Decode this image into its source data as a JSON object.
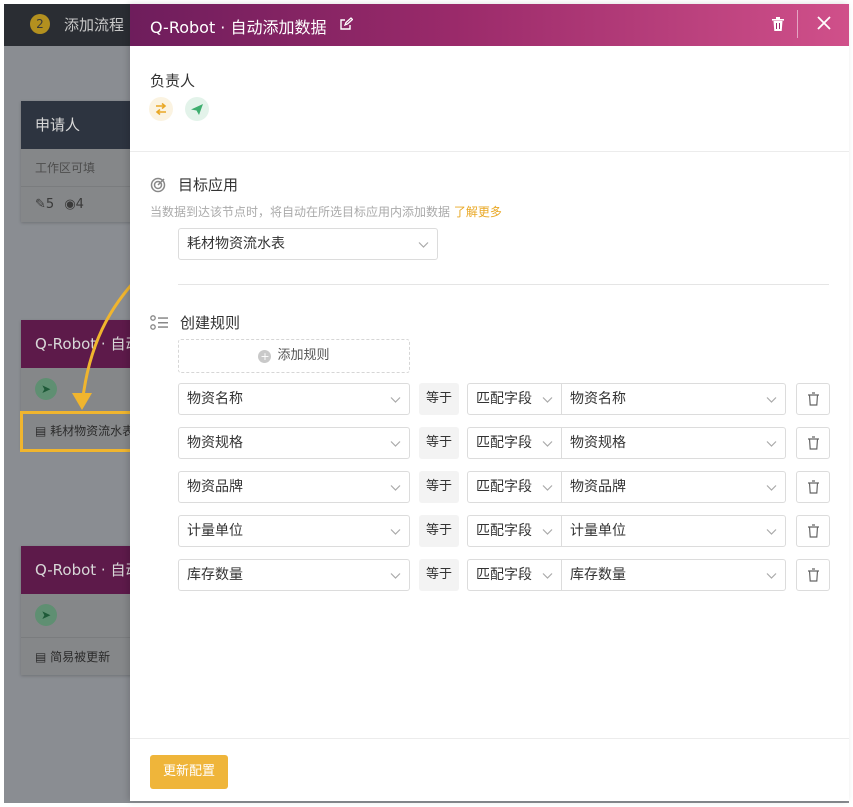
{
  "background": {
    "step_number": "2",
    "top_title": "添加流程",
    "cards": [
      {
        "title": "申请人",
        "subtitle": "工作区可填",
        "edit_count": "5",
        "view_count": "4"
      },
      {
        "title": "Q-Robot · 自动",
        "footer": "耗材物资流水表"
      },
      {
        "title": "Q-Robot · 自动",
        "footer": "简易被更新"
      }
    ]
  },
  "modal": {
    "title": "Q-Robot · 自动添加数据",
    "owner_label": "负责人",
    "target": {
      "label": "目标应用",
      "hint": "当数据到达该节点时，将自动在所选目标应用内添加数据",
      "link": "了解更多",
      "selected_app": "耗材物资流水表"
    },
    "rules": {
      "label": "创建规则",
      "add_label": "添加规则",
      "equals_label": "等于",
      "match_label": "匹配字段",
      "rows": [
        {
          "target_field": "物资名称",
          "source_field": "物资名称"
        },
        {
          "target_field": "物资规格",
          "source_field": "物资规格"
        },
        {
          "target_field": "物资品牌",
          "source_field": "物资品牌"
        },
        {
          "target_field": "计量单位",
          "source_field": "计量单位"
        },
        {
          "target_field": "库存数量",
          "source_field": "库存数量"
        }
      ]
    },
    "update_label": "更新配置"
  },
  "colors": {
    "accent": "#efb53a",
    "header_gradient_start": "#6e1d5c",
    "header_gradient_end": "#d0508a",
    "highlight": "#f0b52e"
  }
}
